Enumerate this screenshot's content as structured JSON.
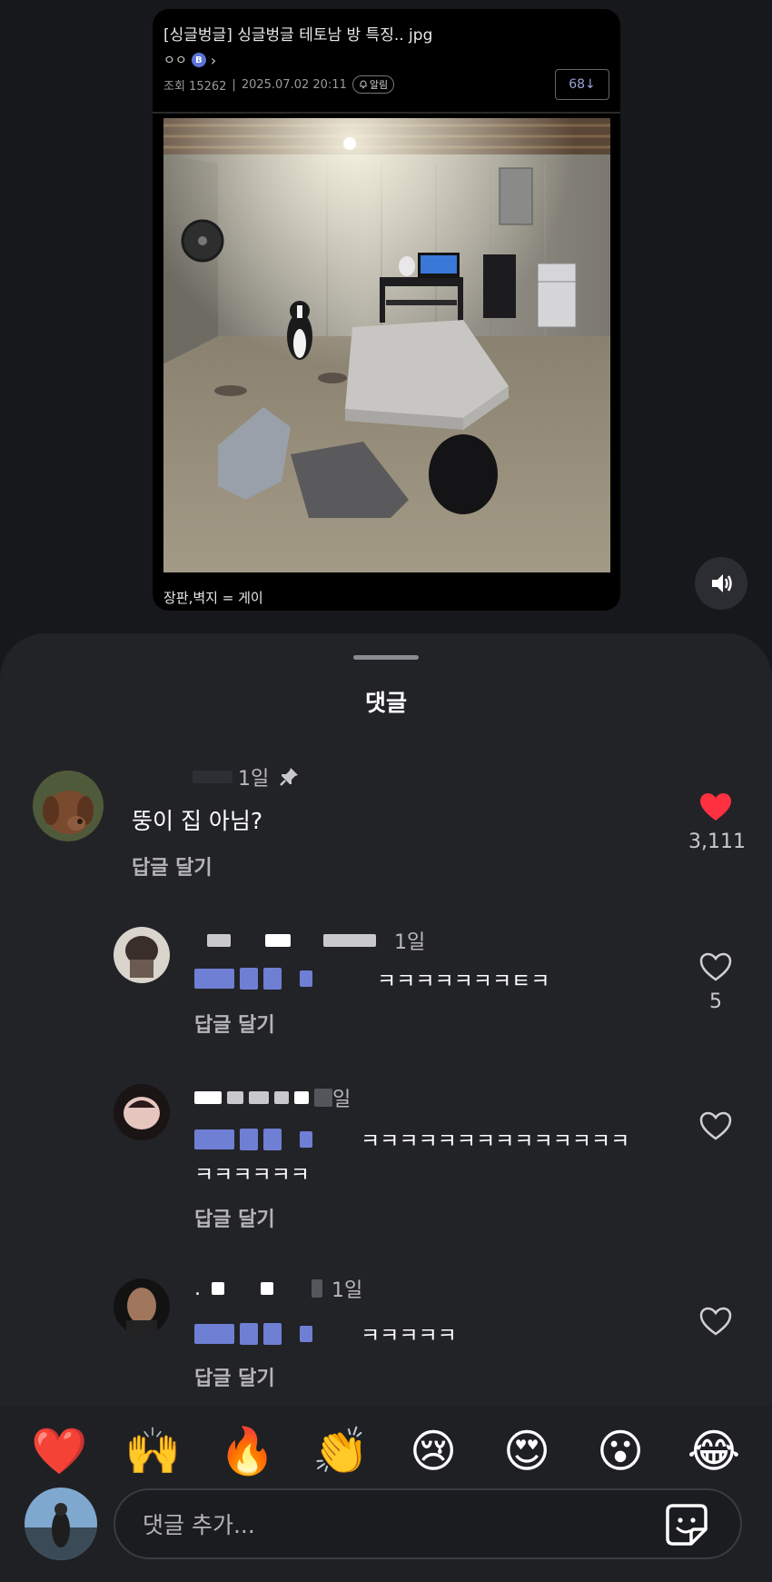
{
  "post": {
    "title": "[싱글벙글] 싱글벙글 테토남 방 특징.. jpg",
    "author": "ㅇㅇ",
    "badge": "B",
    "views_label": "조회 15262",
    "separator": "|",
    "date": "2025.07.02 20:11",
    "alarm_label": "알림",
    "comment_count": "68↓",
    "caption": "장판,벽지 = 게이"
  },
  "sheet": {
    "title": "댓글"
  },
  "comments": [
    {
      "time": "1일",
      "text": "뚱이 집 아님?",
      "reply_label": "답글 달기",
      "like_count": "3,111",
      "liked": true
    },
    {
      "time": "1일",
      "text": "ㅋㅋㅋㅋㅋㅋㅋㅌㅋ",
      "reply_label": "답글 달기",
      "like_count": "5",
      "liked": false
    },
    {
      "time": "일",
      "text_line1": "ㅋㅋㅋㅋㅋㅋㅋㅋㅋㅋㅋㅋㅋㅋ",
      "text_line2": "ㅋㅋㅋㅋㅋㅋ",
      "reply_label": "답글 달기",
      "liked": false
    },
    {
      "time": "1일",
      "text": "ㅋㅋㅋㅋㅋ",
      "reply_label": "답글 달기",
      "liked": false
    }
  ],
  "emojis": [
    "❤️",
    "🙌",
    "🔥",
    "👏",
    "😢",
    "😍",
    "😮",
    "😂"
  ],
  "input": {
    "placeholder": "댓글 추가..."
  },
  "colors": {
    "background": "#17181b",
    "sheet": "#222327",
    "like_red": "#ff3040",
    "badge_blue": "#5a74d8"
  }
}
